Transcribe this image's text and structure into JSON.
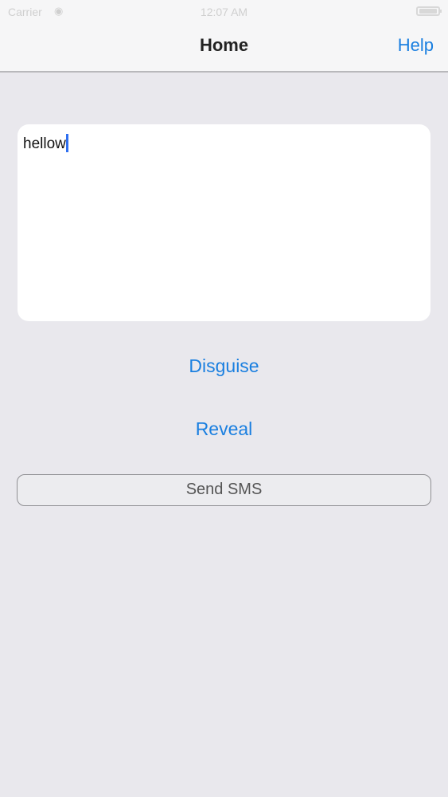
{
  "status_bar": {
    "carrier": "Carrier",
    "time": "12:07 AM",
    "wifi_icon": "wifi-icon",
    "battery_icon": "battery-icon"
  },
  "nav": {
    "title": "Home",
    "help_label": "Help"
  },
  "message": {
    "value": "hellow"
  },
  "actions": {
    "disguise_label": "Disguise",
    "reveal_label": "Reveal",
    "send_sms_label": "Send SMS"
  },
  "colors": {
    "accent": "#1a7fe0",
    "background": "#e9e8ed",
    "bar": "#f6f6f7"
  }
}
